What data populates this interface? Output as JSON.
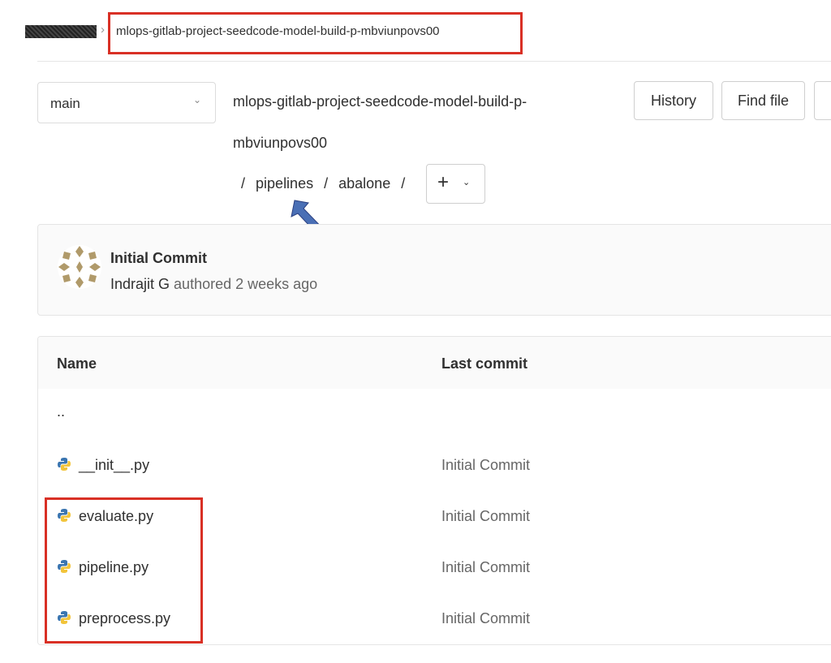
{
  "breadcrumb": {
    "separator": "›",
    "project": "mlops-gitlab-project-seedcode-model-build-p-mbviunpovs00"
  },
  "branch": {
    "selected": "main",
    "chevron_icon": "chevron-down-icon"
  },
  "path": {
    "title_line1": "mlops-gitlab-project-seedcode-model-build-p-",
    "title_line2": "mbviunpovs00",
    "sep": "/",
    "segments": [
      "pipelines",
      "abalone"
    ],
    "add_label": "+"
  },
  "toolbar": {
    "history": "History",
    "find_file": "Find file"
  },
  "commit": {
    "title": "Initial Commit",
    "author": "Indrajit G",
    "meta": "authored 2 weeks ago"
  },
  "table": {
    "headers": {
      "name": "Name",
      "last_commit": "Last commit"
    },
    "parent": "..",
    "rows": [
      {
        "name": "__init__.py",
        "commit": "Initial Commit"
      },
      {
        "name": "evaluate.py",
        "commit": "Initial Commit"
      },
      {
        "name": "pipeline.py",
        "commit": "Initial Commit"
      },
      {
        "name": "preprocess.py",
        "commit": "Initial Commit"
      }
    ]
  },
  "colors": {
    "highlight": "#d93025",
    "arrow": "#4a6fb5",
    "python_blue": "#3a75b0",
    "python_yellow": "#f2c43a"
  }
}
